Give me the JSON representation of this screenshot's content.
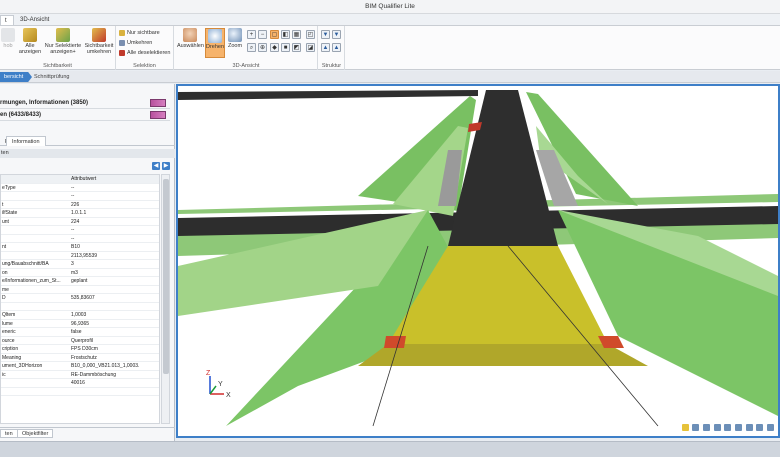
{
  "window": {
    "title": "BIM Qualifier Lite"
  },
  "tabs": [
    {
      "label": "t"
    },
    {
      "label": "3D-Ansicht"
    }
  ],
  "ribbon": {
    "buttons": {
      "alle_anzeigen": "Alle anzeigen",
      "nur_selektierte": "Nur Selektierte anzeigen+",
      "sichtbarkeit_umkehren": "Sichtbarkeit umkehren",
      "auswaehlen": "Auswählen",
      "drehen": "Drehen",
      "zoom": "Zoom"
    },
    "selection_items": [
      "Nur sichtbare",
      "Umkehren",
      "Alle deselektieren"
    ],
    "groups": {
      "sichtbarkeit": "Sichtbarkeit",
      "selektion": "Selektion",
      "ansicht3d": "3D-Ansicht",
      "struktur": "Struktur"
    }
  },
  "breadcrumb": {
    "active": "bersicht",
    "next": "Schnittprüfung"
  },
  "left_panel": {
    "row1": "rmungen, Informationen (3850)",
    "row2": "en (6433/8433)",
    "tab_information": "Information",
    "tab_other": "p",
    "section_header": "ten",
    "table_header": {
      "col1": "",
      "col2": "Attributwert"
    },
    "rows": [
      {
        "k": "eType",
        "v": "--"
      },
      {
        "k": "",
        "v": "--"
      },
      {
        "k": "t",
        "v": "226"
      },
      {
        "k": "ilfState",
        "v": "1.0.1.1"
      },
      {
        "k": "unt",
        "v": "224"
      },
      {
        "k": "",
        "v": "--"
      },
      {
        "k": "",
        "v": "--"
      },
      {
        "k": "nt",
        "v": "B10"
      },
      {
        "k": "",
        "v": "2113,95539"
      },
      {
        "k": "ung/Bauabschnitt/BA",
        "v": "3"
      },
      {
        "k": "on",
        "v": "m3"
      },
      {
        "k": "e/Informationen_zum_St...",
        "v": "geplant"
      },
      {
        "k": "me",
        "v": ""
      },
      {
        "k": "D",
        "v": "535,83607"
      },
      {
        "k": "",
        "v": ""
      },
      {
        "k": "Qltem",
        "v": "1,0003"
      },
      {
        "k": "lume",
        "v": "96,9365"
      },
      {
        "k": "eneric",
        "v": "false"
      },
      {
        "k": "ource",
        "v": "Querprofil"
      },
      {
        "k": "cription",
        "v": "FPS D30cm"
      },
      {
        "k": "Meaning",
        "v": "Frostschutz"
      },
      {
        "k": "ument_3DHorizon",
        "v": "B10_0,000_VB21.013_1,0003."
      },
      {
        "k": "ic",
        "v": "RE-Dammböschung"
      },
      {
        "k": "",
        "v": "40016"
      },
      {
        "k": "",
        "v": ""
      }
    ],
    "bottom_tabs": [
      "ten",
      "Objektfilter"
    ]
  },
  "viewport": {
    "axis_labels": {
      "x": "X",
      "y": "Y",
      "z": "Z"
    }
  }
}
